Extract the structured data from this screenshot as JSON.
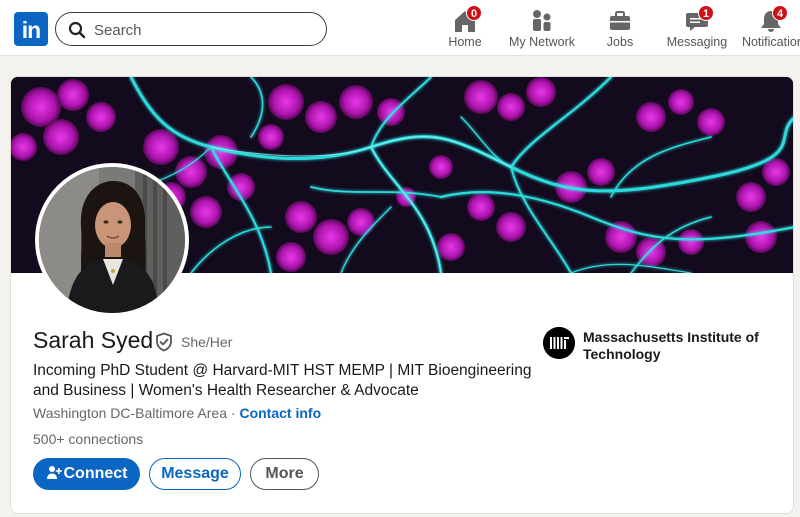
{
  "nav": {
    "search_placeholder": "Search",
    "items": [
      {
        "label": "Home",
        "badge": "0",
        "icon": "home-icon"
      },
      {
        "label": "My Network",
        "badge": "",
        "icon": "network-icon"
      },
      {
        "label": "Jobs",
        "badge": "",
        "icon": "briefcase-icon"
      },
      {
        "label": "Messaging",
        "badge": "1",
        "icon": "messaging-icon"
      },
      {
        "label": "Notifications",
        "badge": "4",
        "icon": "bell-icon"
      }
    ]
  },
  "profile": {
    "name": "Sarah Syed",
    "pronouns": "She/Her",
    "headline": "Incoming PhD Student @ Harvard-MIT HST MEMP | MIT Bioengineering and Business | Women's Health Researcher & Advocate",
    "location": "Washington DC-Baltimore Area",
    "location_separator": " · ",
    "contact_info": "Contact info",
    "connections": "500+ connections",
    "organization": "Massachusetts Institute of Technology"
  },
  "actions": {
    "connect": "Connect",
    "message": "Message",
    "more": "More"
  },
  "colors": {
    "brand": "#0a66c2",
    "badge": "#cc1016",
    "banner_cyan": "#2ee6e6",
    "banner_magenta": "#d21fd2"
  }
}
